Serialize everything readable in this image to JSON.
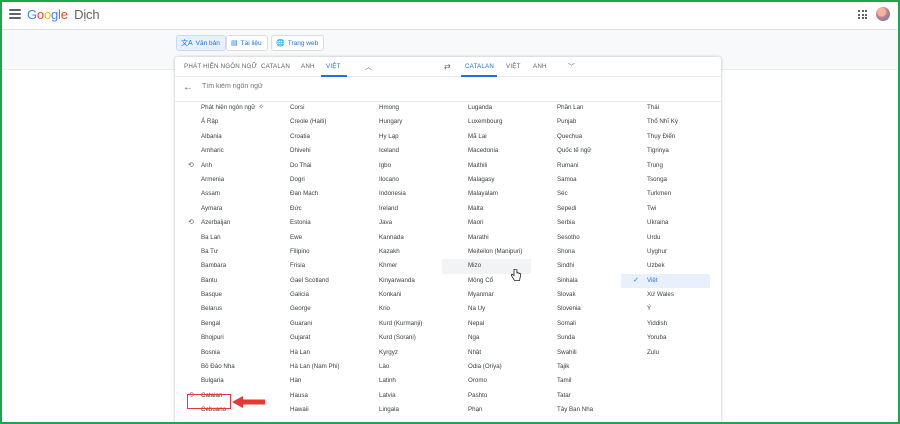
{
  "app": {
    "logo_letters": [
      "G",
      "o",
      "o",
      "g",
      "l",
      "e"
    ],
    "product_name": "Dịch"
  },
  "mode_buttons": [
    {
      "icon": "translate-icon",
      "label": "Văn bản",
      "active": true
    },
    {
      "icon": "document-icon",
      "label": "Tài liệu",
      "active": false
    },
    {
      "icon": "globe-icon",
      "label": "Trang web",
      "active": false
    }
  ],
  "source_tabs": [
    "PHÁT HIỆN NGÔN NGỮ",
    "CATALAN",
    "ANH",
    "VIỆT"
  ],
  "target_tabs": [
    "CATALAN",
    "VIỆT",
    "ANH"
  ],
  "search": {
    "placeholder": "Tìm kiếm ngôn ngữ"
  },
  "columns": [
    {
      "items": [
        {
          "label": "Phát hiện ngôn ngữ",
          "sparkle": true
        },
        {
          "label": "Ả Rập"
        },
        {
          "label": "Albania"
        },
        {
          "label": "Amharic"
        },
        {
          "label": "Anh",
          "history": true
        },
        {
          "label": "Armenia"
        },
        {
          "label": "Assam"
        },
        {
          "label": "Aymara"
        },
        {
          "label": "Azerbaijan",
          "history": true
        },
        {
          "label": "Ba Lan"
        },
        {
          "label": "Ba Tư"
        },
        {
          "label": "Bambara"
        },
        {
          "label": "Bantu"
        },
        {
          "label": "Basque"
        },
        {
          "label": "Belarus"
        },
        {
          "label": "Bengal"
        },
        {
          "label": "Bhojpuri"
        },
        {
          "label": "Bosnia"
        },
        {
          "label": "Bồ Đào Nha"
        },
        {
          "label": "Bulgaria"
        },
        {
          "label": "Catalan",
          "history": true
        },
        {
          "label": "Cebuano"
        }
      ]
    },
    {
      "items": [
        {
          "label": "Corsi"
        },
        {
          "label": "Creole (Haiti)"
        },
        {
          "label": "Croatia"
        },
        {
          "label": "Dhivehi"
        },
        {
          "label": "Do Thái"
        },
        {
          "label": "Dogri"
        },
        {
          "label": "Đan Mạch"
        },
        {
          "label": "Đức"
        },
        {
          "label": "Estonia"
        },
        {
          "label": "Ewe"
        },
        {
          "label": "Filipino"
        },
        {
          "label": "Frisia"
        },
        {
          "label": "Gael Scotland"
        },
        {
          "label": "Galicia"
        },
        {
          "label": "George"
        },
        {
          "label": "Guarani"
        },
        {
          "label": "Gujarat"
        },
        {
          "label": "Hà Lan"
        },
        {
          "label": "Hà Lan (Nam Phi)"
        },
        {
          "label": "Hàn"
        },
        {
          "label": "Hausa"
        },
        {
          "label": "Hawaii"
        }
      ]
    },
    {
      "items": [
        {
          "label": "Hmong"
        },
        {
          "label": "Hungary"
        },
        {
          "label": "Hy Lạp"
        },
        {
          "label": "Iceland"
        },
        {
          "label": "Igbo"
        },
        {
          "label": "Ilocano"
        },
        {
          "label": "Indonesia"
        },
        {
          "label": "Ireland"
        },
        {
          "label": "Java"
        },
        {
          "label": "Kannada"
        },
        {
          "label": "Kazakh"
        },
        {
          "label": "Khmer"
        },
        {
          "label": "Kinyarwanda"
        },
        {
          "label": "Konkani"
        },
        {
          "label": "Krio"
        },
        {
          "label": "Kurd (Kurmanji)"
        },
        {
          "label": "Kurd (Sorani)"
        },
        {
          "label": "Kyrgyz"
        },
        {
          "label": "Lào"
        },
        {
          "label": "Latinh"
        },
        {
          "label": "Latvia"
        },
        {
          "label": "Lingala"
        }
      ]
    },
    {
      "items": [
        {
          "label": "Luganda"
        },
        {
          "label": "Luxembourg"
        },
        {
          "label": "Mã Lai"
        },
        {
          "label": "Macedonia"
        },
        {
          "label": "Maithili"
        },
        {
          "label": "Malagasy"
        },
        {
          "label": "Malayalam"
        },
        {
          "label": "Malta"
        },
        {
          "label": "Maori"
        },
        {
          "label": "Marathi"
        },
        {
          "label": "Meiteilon (Manipuri)"
        },
        {
          "label": "Mizo",
          "hover": true
        },
        {
          "label": "Mông Cổ"
        },
        {
          "label": "Myanmar"
        },
        {
          "label": "Na Uy"
        },
        {
          "label": "Nepal"
        },
        {
          "label": "Nga"
        },
        {
          "label": "Nhật"
        },
        {
          "label": "Odia (Oriya)"
        },
        {
          "label": "Oromo"
        },
        {
          "label": "Pashto"
        },
        {
          "label": "Phạn"
        }
      ]
    },
    {
      "items": [
        {
          "label": "Phần Lan"
        },
        {
          "label": "Punjab"
        },
        {
          "label": "Quechua"
        },
        {
          "label": "Quốc tế ngữ"
        },
        {
          "label": "Rumani"
        },
        {
          "label": "Samoa"
        },
        {
          "label": "Séc"
        },
        {
          "label": "Sepedi"
        },
        {
          "label": "Serbia"
        },
        {
          "label": "Sesotho"
        },
        {
          "label": "Shona"
        },
        {
          "label": "Sindhi"
        },
        {
          "label": "Sinhala"
        },
        {
          "label": "Slovak"
        },
        {
          "label": "Slovenia"
        },
        {
          "label": "Somali"
        },
        {
          "label": "Sunda"
        },
        {
          "label": "Swahili"
        },
        {
          "label": "Tajik"
        },
        {
          "label": "Tamil"
        },
        {
          "label": "Tatar"
        },
        {
          "label": "Tây Ban Nha"
        }
      ]
    },
    {
      "items": [
        {
          "label": "Thái"
        },
        {
          "label": "Thổ Nhĩ Kỳ"
        },
        {
          "label": "Thụy Điển"
        },
        {
          "label": "Tigrinya"
        },
        {
          "label": "Trung"
        },
        {
          "label": "Tsonga"
        },
        {
          "label": "Turkmen"
        },
        {
          "label": "Twi"
        },
        {
          "label": "Ukraina"
        },
        {
          "label": "Urdu"
        },
        {
          "label": "Uyghur"
        },
        {
          "label": "Uzbek"
        },
        {
          "label": "Việt",
          "selected": true
        },
        {
          "label": "Xứ Wales"
        },
        {
          "label": "Ý"
        },
        {
          "label": "Yiddish"
        },
        {
          "label": "Yoruba"
        },
        {
          "label": "Zulu"
        }
      ]
    }
  ],
  "colors": {
    "accent": "#1a73e8",
    "frame": "#1ea64a",
    "annotation": "#e53935"
  }
}
